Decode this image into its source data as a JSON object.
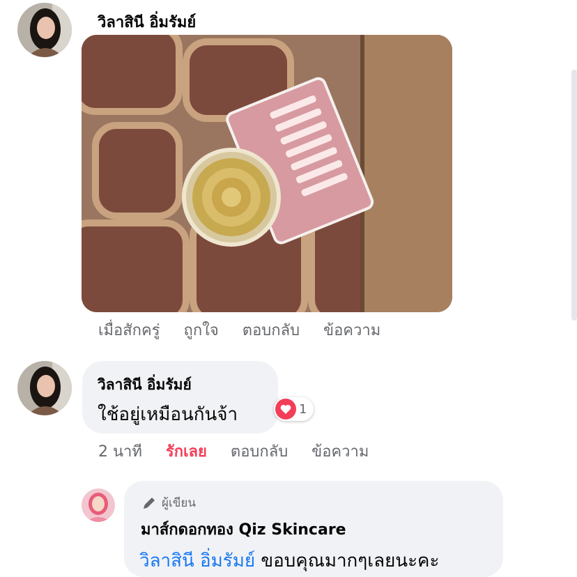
{
  "comment1": {
    "author": "วิลาสินี อิ่มรัมย์",
    "actions": [
      "เมื่อสักครู่",
      "ถูกใจ",
      "ตอบกลับ",
      "ข้อความ"
    ]
  },
  "comment2": {
    "author": "วิลาสินี อิ่มรัมย์",
    "text": "ใช้อยู่เหมือนกันจ้า",
    "reaction_count": "1",
    "time": "2 นาที",
    "like_label": "รักเลย",
    "reply_label": "ตอบกลับ",
    "message_label": "ข้อความ"
  },
  "reply": {
    "badge": "ผู้เขียน",
    "author": "มาส์กดอกทอง Qiz Skincare",
    "mention": "วิลาสินี อิ่มรัมย์",
    "text": "ขอบคุณมากๆเลยนะคะ"
  },
  "colors": {
    "bubble": "#f0f2f5",
    "link": "#1877f2",
    "love": "#f33e58",
    "meta": "#65676b"
  }
}
